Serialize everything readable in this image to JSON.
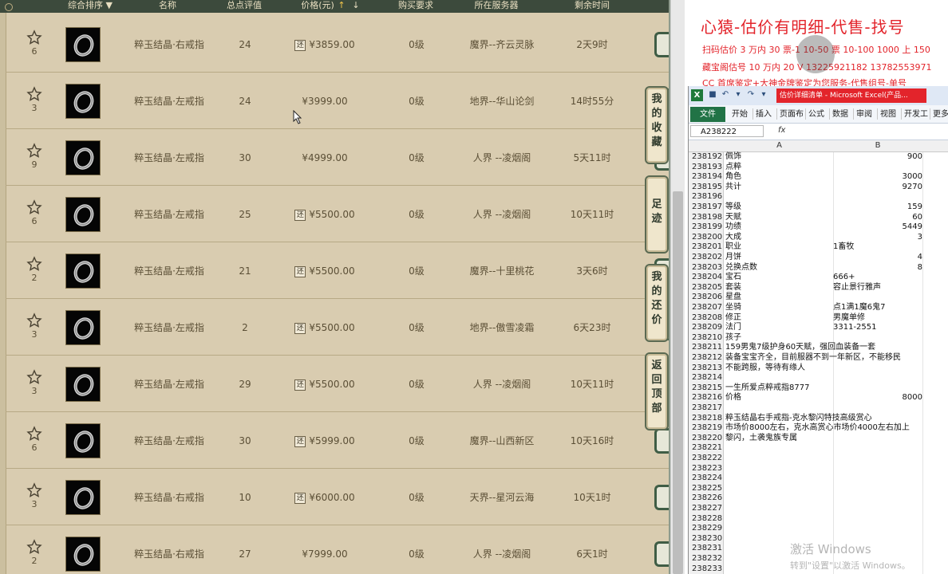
{
  "market": {
    "headers": {
      "sort": "综合排序 ▼",
      "name": "名称",
      "score": "总点评值",
      "price": "价格(元)",
      "price_up": "↑",
      "price_down": "↓",
      "level": "购买要求",
      "server": "所在服务器",
      "time": "剩余时间"
    },
    "rows": [
      {
        "stars": "6",
        "name": "粹玉结晶·右戒指",
        "score": "24",
        "huan": true,
        "price": "¥3859.00",
        "level": "0级",
        "server": "魔界--齐云灵脉",
        "time": "2天9时"
      },
      {
        "stars": "3",
        "name": "粹玉结晶·左戒指",
        "score": "24",
        "huan": false,
        "price": "¥3999.00",
        "level": "0级",
        "server": "地界--华山论剑",
        "time": "14时55分"
      },
      {
        "stars": "9",
        "name": "粹玉结晶·左戒指",
        "score": "30",
        "huan": false,
        "price": "¥4999.00",
        "level": "0级",
        "server": "人界 --凌烟阁",
        "time": "5天11时"
      },
      {
        "stars": "6",
        "name": "粹玉结晶·左戒指",
        "score": "25",
        "huan": true,
        "price": "¥5500.00",
        "level": "0级",
        "server": "人界 --凌烟阁",
        "time": "10天11时"
      },
      {
        "stars": "2",
        "name": "粹玉结晶·左戒指",
        "score": "21",
        "huan": true,
        "price": "¥5500.00",
        "level": "0级",
        "server": "魔界--十里桃花",
        "time": "3天6时"
      },
      {
        "stars": "3",
        "name": "粹玉结晶·左戒指",
        "score": "2",
        "huan": true,
        "price": "¥5500.00",
        "level": "0级",
        "server": "地界--傲雪凌霜",
        "time": "6天23时"
      },
      {
        "stars": "3",
        "name": "粹玉结晶·左戒指",
        "score": "29",
        "huan": true,
        "price": "¥5500.00",
        "level": "0级",
        "server": "人界 --凌烟阁",
        "time": "10天11时"
      },
      {
        "stars": "6",
        "name": "粹玉结晶·左戒指",
        "score": "30",
        "huan": true,
        "price": "¥5999.00",
        "level": "0级",
        "server": "魔界--山西新区",
        "time": "10天16时"
      },
      {
        "stars": "3",
        "name": "粹玉结晶·右戒指",
        "score": "10",
        "huan": true,
        "price": "¥6000.00",
        "level": "0级",
        "server": "天界--星河云海",
        "time": "10天1时"
      },
      {
        "stars": "2",
        "name": "粹玉结晶·右戒指",
        "score": "27",
        "huan": false,
        "price": "¥7999.00",
        "level": "0级",
        "server": "人界 --凌烟阁",
        "time": "6天1时"
      }
    ],
    "huan_label": "还",
    "float_buttons": {
      "favorites": [
        "我",
        "的",
        "收",
        "藏"
      ],
      "footprint": [
        "足",
        "迹"
      ],
      "bargain": [
        "我",
        "的",
        "还",
        "价"
      ],
      "top": [
        "返",
        "回",
        "顶",
        "部"
      ]
    }
  },
  "notes": {
    "title": "心猿-估价有明细-代售-找号",
    "line1": "扫码估价 3 万内 30 票-1 10-50 票 10-100 1000 上 150",
    "line2": "藏宝阁估号 10 万内 20 V 13225921182   13782553971",
    "line3": "CC 首席鉴定+大神金牌鉴定为您服务-代售组号-单号"
  },
  "excel": {
    "title": "估价详细清单 - Microsoft Excel(产品...",
    "tabs": [
      "开始",
      "插入",
      "页面布",
      "公式",
      "数据",
      "审阅",
      "视图",
      "开发工",
      "更多"
    ],
    "file_tab": "文件",
    "namebox": "A238222",
    "fx": "fx",
    "col_a": "A",
    "col_b": "B",
    "rows": [
      {
        "n": "238192",
        "a": "佩饰",
        "b": "900",
        "num": true
      },
      {
        "n": "238193",
        "a": "点粹",
        "b": "",
        "num": false
      },
      {
        "n": "238194",
        "a": "角色",
        "b": "3000",
        "num": true
      },
      {
        "n": "238195",
        "a": "共计",
        "b": "9270",
        "num": true
      },
      {
        "n": "238196",
        "a": "",
        "b": "",
        "num": false
      },
      {
        "n": "238197",
        "a": "等级",
        "b": "159",
        "num": true
      },
      {
        "n": "238198",
        "a": "天赋",
        "b": "60",
        "num": true
      },
      {
        "n": "238199",
        "a": "功绩",
        "b": "5449",
        "num": true
      },
      {
        "n": "238200",
        "a": "大成",
        "b": "3",
        "num": true
      },
      {
        "n": "238201",
        "a": "职业",
        "b": "1畜牧",
        "num": false
      },
      {
        "n": "238202",
        "a": "月饼",
        "b": "4",
        "num": true
      },
      {
        "n": "238203",
        "a": "兑换点数",
        "b": "8",
        "num": true
      },
      {
        "n": "238204",
        "a": "宝石",
        "b": "666+",
        "num": false
      },
      {
        "n": "238205",
        "a": "套装",
        "b": "容止景行雅声",
        "num": false
      },
      {
        "n": "238206",
        "a": "星盘",
        "b": "",
        "num": false
      },
      {
        "n": "238207",
        "a": "坐骑",
        "b": "点1满1魔6鬼7",
        "num": false
      },
      {
        "n": "238208",
        "a": "修正",
        "b": "男魔单修",
        "num": false
      },
      {
        "n": "238209",
        "a": "法门",
        "b": "3311-2551",
        "num": false
      },
      {
        "n": "238210",
        "a": "孩子",
        "b": "",
        "num": false
      },
      {
        "n": "238211",
        "a": "159男鬼7级护身60天赋，强回血装备一套",
        "b": "",
        "num": false
      },
      {
        "n": "238212",
        "a": "装备宝宝齐全，目前服器不到一年新区，不能移民",
        "b": "",
        "num": false
      },
      {
        "n": "238213",
        "a": "不能跨服，等待有缘人",
        "b": "",
        "num": false
      },
      {
        "n": "238214",
        "a": "",
        "b": "",
        "num": false
      },
      {
        "n": "238215",
        "a": "一生所爱点粹戒指8777",
        "b": "",
        "num": false
      },
      {
        "n": "238216",
        "a": "价格",
        "b": "8000",
        "num": true
      },
      {
        "n": "238217",
        "a": "",
        "b": "",
        "num": false
      },
      {
        "n": "238218",
        "a": "粹玉结晶右手戒指-克水黎闪特技高级赏心",
        "b": "",
        "num": false
      },
      {
        "n": "238219",
        "a": "市场价8000左右，克水高赏心市场价4000左右加上",
        "b": "",
        "num": false
      },
      {
        "n": "238220",
        "a": "黎闪，土袭鬼族专属",
        "b": "",
        "num": false
      },
      {
        "n": "238221",
        "a": "",
        "b": "",
        "num": false
      },
      {
        "n": "238222",
        "a": "",
        "b": "",
        "num": false
      },
      {
        "n": "238223",
        "a": "",
        "b": "",
        "num": false
      },
      {
        "n": "238224",
        "a": "",
        "b": "",
        "num": false
      },
      {
        "n": "238225",
        "a": "",
        "b": "",
        "num": false
      },
      {
        "n": "238226",
        "a": "",
        "b": "",
        "num": false
      },
      {
        "n": "238227",
        "a": "",
        "b": "",
        "num": false
      },
      {
        "n": "238228",
        "a": "",
        "b": "",
        "num": false
      },
      {
        "n": "238229",
        "a": "",
        "b": "",
        "num": false
      },
      {
        "n": "238230",
        "a": "",
        "b": "",
        "num": false
      },
      {
        "n": "238231",
        "a": "",
        "b": "",
        "num": false
      },
      {
        "n": "238232",
        "a": "",
        "b": "",
        "num": false
      },
      {
        "n": "238233",
        "a": "",
        "b": "",
        "num": false
      }
    ]
  },
  "watermark": {
    "line1": "激活 Windows",
    "line2": "转到\"设置\"以激活 Windows。"
  }
}
